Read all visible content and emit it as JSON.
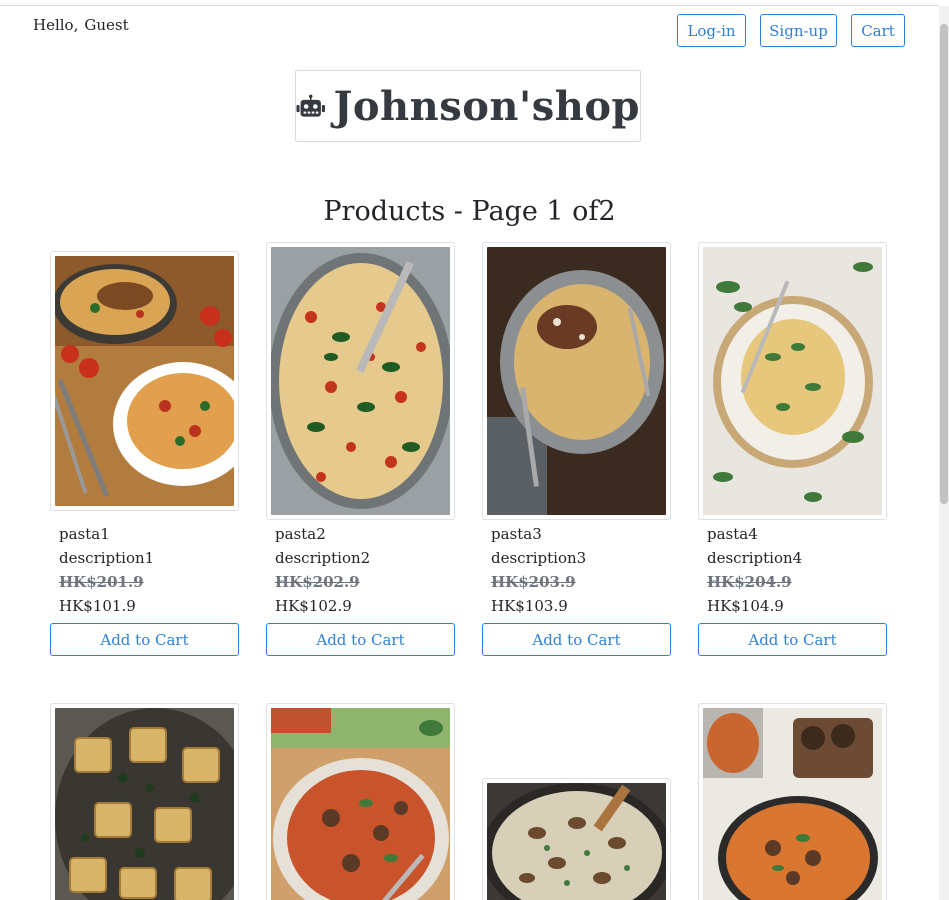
{
  "header": {
    "greeting_hello": "Hello,",
    "greeting_user": "Guest",
    "login_label": "Log-in",
    "signup_label": "Sign-up",
    "cart_label": "Cart"
  },
  "brand": {
    "logo_icon": "robot-icon",
    "name": "Johnson'shop"
  },
  "products_heading": "Products - Page 1 of2",
  "colors": {
    "accent": "#2f7fd6",
    "text": "#212529",
    "muted": "#6c757d"
  },
  "products": [
    {
      "name": "pasta1",
      "description": "description1",
      "old_price": "HK$201.9",
      "price": "HK$101.9",
      "button": "Add to Cart"
    },
    {
      "name": "pasta2",
      "description": "description2",
      "old_price": "HK$202.9",
      "price": "HK$102.9",
      "button": "Add to Cart"
    },
    {
      "name": "pasta3",
      "description": "description3",
      "old_price": "HK$203.9",
      "price": "HK$103.9",
      "button": "Add to Cart"
    },
    {
      "name": "pasta4",
      "description": "description4",
      "old_price": "HK$204.9",
      "price": "HK$104.9",
      "button": "Add to Cart"
    }
  ]
}
